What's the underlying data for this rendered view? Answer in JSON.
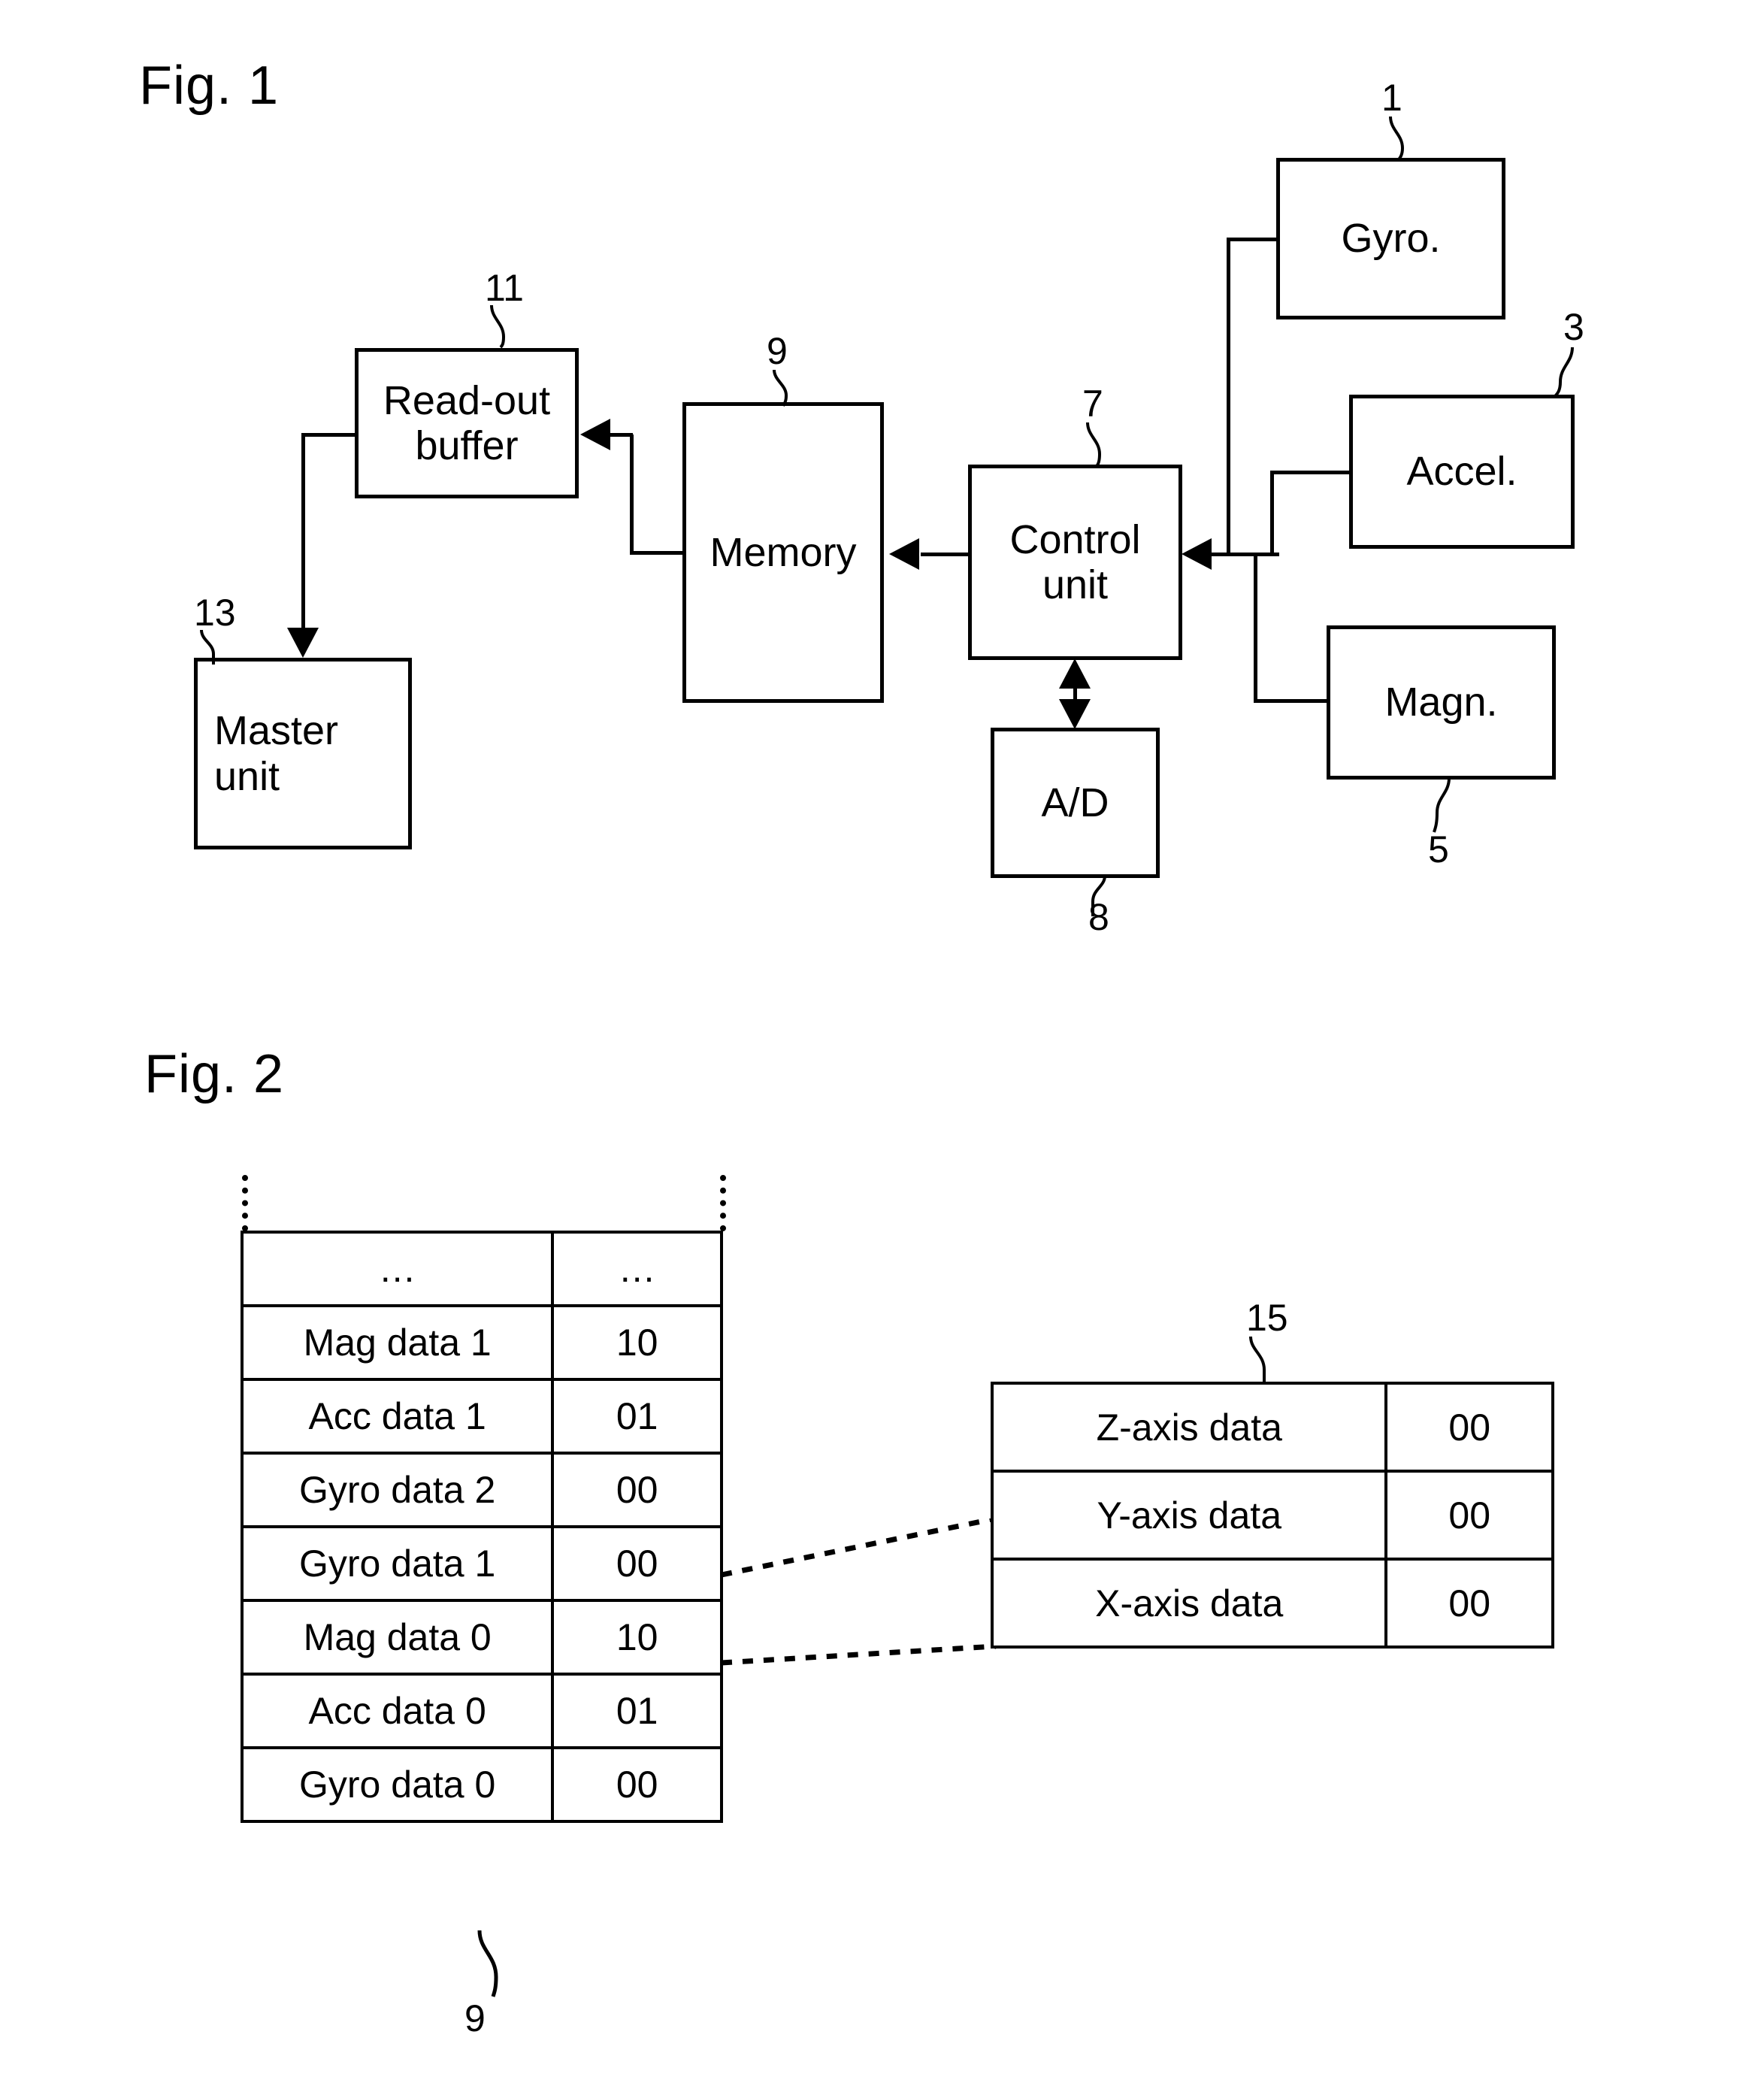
{
  "figures": {
    "fig1": {
      "title": "Fig. 1",
      "blocks": [
        {
          "id": "gyro",
          "label": "Gyro.",
          "ref": "1"
        },
        {
          "id": "accel",
          "label": "Accel.",
          "ref": "3"
        },
        {
          "id": "magn",
          "label": "Magn.",
          "ref": "5"
        },
        {
          "id": "control",
          "label": "Control\nunit",
          "ref": "7"
        },
        {
          "id": "ad",
          "label": "A/D",
          "ref": "8"
        },
        {
          "id": "memory",
          "label": "Memory",
          "ref": "9"
        },
        {
          "id": "buffer",
          "label": "Read-out\nbuffer",
          "ref": "11"
        },
        {
          "id": "master",
          "label": "Master\nunit",
          "ref": "13"
        }
      ]
    },
    "fig2": {
      "title": "Fig. 2",
      "memory_table": {
        "ref": "9",
        "rows": [
          {
            "name": "…",
            "value": "…"
          },
          {
            "name": "Mag data 1",
            "value": "10"
          },
          {
            "name": "Acc data 1",
            "value": "01"
          },
          {
            "name": "Gyro data 2",
            "value": "00"
          },
          {
            "name": "Gyro data 1",
            "value": "00"
          },
          {
            "name": "Mag data 0",
            "value": "10"
          },
          {
            "name": "Acc data 0",
            "value": "01"
          },
          {
            "name": "Gyro data 0",
            "value": "00"
          }
        ]
      },
      "axis_table": {
        "ref": "15",
        "rows": [
          {
            "name": "Z-axis data",
            "value": "00"
          },
          {
            "name": "Y-axis data",
            "value": "00"
          },
          {
            "name": "X-axis data",
            "value": "00"
          }
        ]
      }
    }
  },
  "colors": {
    "ink": "#000000",
    "paper": "#ffffff"
  }
}
